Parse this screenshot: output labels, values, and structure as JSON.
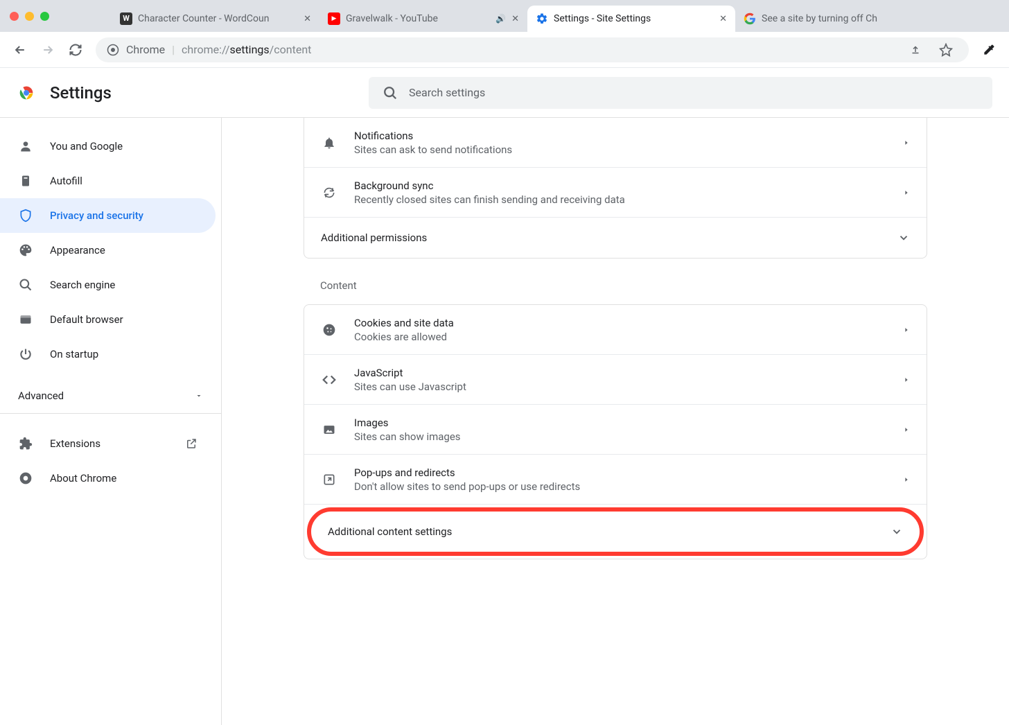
{
  "tabs": [
    {
      "title": "Character Counter - WordCoun",
      "icon": "W"
    },
    {
      "title": "Gravelwalk - YouTube"
    },
    {
      "title": "Settings - Site Settings"
    },
    {
      "title": "See a site by turning off Ch"
    }
  ],
  "omnibox": {
    "label": "Chrome",
    "url_prefix": "chrome://",
    "url_bold": "settings",
    "url_suffix": "/content"
  },
  "header": {
    "title": "Settings",
    "search_placeholder": "Search settings"
  },
  "sidebar": {
    "items": [
      {
        "label": "You and Google"
      },
      {
        "label": "Autofill"
      },
      {
        "label": "Privacy and security"
      },
      {
        "label": "Appearance"
      },
      {
        "label": "Search engine"
      },
      {
        "label": "Default browser"
      },
      {
        "label": "On startup"
      }
    ],
    "advanced": "Advanced",
    "extensions": "Extensions",
    "about": "About Chrome"
  },
  "panel": {
    "top_rows": [
      {
        "title": "Notifications",
        "sub": "Sites can ask to send notifications",
        "icon": "bell"
      },
      {
        "title": "Background sync",
        "sub": "Recently closed sites can finish sending and receiving data",
        "icon": "sync"
      }
    ],
    "additional_permissions": "Additional permissions",
    "content_label": "Content",
    "content_rows": [
      {
        "title": "Cookies and site data",
        "sub": "Cookies are allowed",
        "icon": "cookie"
      },
      {
        "title": "JavaScript",
        "sub": "Sites can use Javascript",
        "icon": "code"
      },
      {
        "title": "Images",
        "sub": "Sites can show images",
        "icon": "image"
      },
      {
        "title": "Pop-ups and redirects",
        "sub": "Don't allow sites to send pop-ups or use redirects",
        "icon": "popup"
      }
    ],
    "additional_content": "Additional content settings"
  }
}
